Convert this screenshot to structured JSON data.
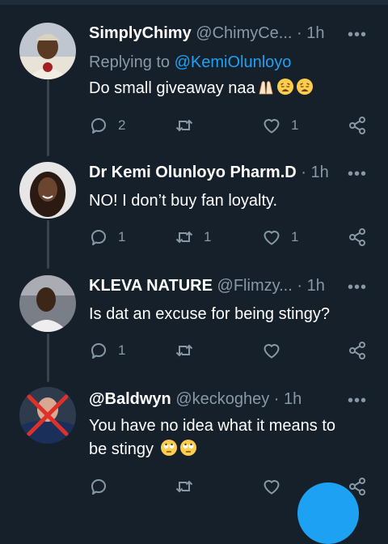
{
  "colors": {
    "background": "#15202b",
    "secondary_text": "#8899a6",
    "accent": "#1da1f2",
    "thread_line": "#38444d"
  },
  "tweets": [
    {
      "name": "SimplyChimy",
      "handle": "@ChimyCe...",
      "separator": "·",
      "time": "1h",
      "replying_label": "Replying to",
      "replying_to": "@KemiOlunloyo",
      "text": "Do small giveaway naa",
      "emojis": [
        "folded-hands-emoji",
        "weary-face-emoji",
        "weary-face-emoji"
      ],
      "reply_count": "2",
      "retweet_count": "",
      "like_count": "1"
    },
    {
      "name": "Dr Kemi Olunloyo Pharm.D",
      "handle": "",
      "separator": "·",
      "time": "1h",
      "text": "NO! I don’t buy fan loyalty.",
      "reply_count": "1",
      "retweet_count": "1",
      "like_count": "1"
    },
    {
      "name": "KLEVA NATURE",
      "handle": "@Flimzy...",
      "separator": "·",
      "time": "1h",
      "text": "Is dat an excuse for being stingy?",
      "reply_count": "1",
      "retweet_count": "",
      "like_count": ""
    },
    {
      "name": "@Baldwyn",
      "handle": "@keckoghey",
      "separator": "·",
      "time": "1h",
      "text_line1": "You have no idea what it means to",
      "text_line2": "be stingy",
      "emojis": [
        "face-with-rolling-eyes-emoji",
        "face-with-rolling-eyes-emoji"
      ],
      "reply_count": "",
      "retweet_count": "",
      "like_count": ""
    }
  ],
  "icons": {
    "more": "more-icon",
    "reply": "reply-icon",
    "retweet": "retweet-icon",
    "like": "heart-icon",
    "share": "share-icon"
  }
}
